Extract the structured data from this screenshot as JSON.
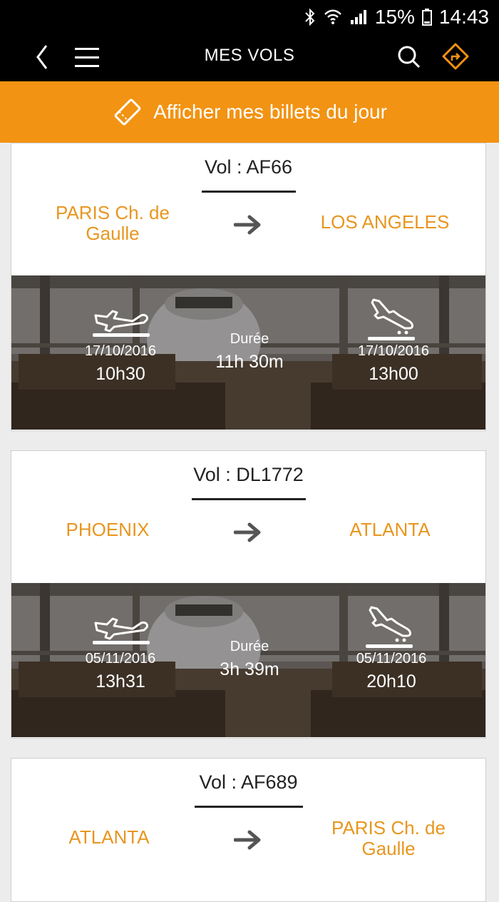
{
  "status_bar": {
    "battery": "15%",
    "time": "14:43"
  },
  "app_bar": {
    "title": "MES VOLS"
  },
  "banner": {
    "label": "Afficher mes billets du jour"
  },
  "flights": [
    {
      "flight_label": "Vol : AF66",
      "from": "PARIS Ch. de Gaulle",
      "to": "LOS ANGELES",
      "departure_date": "17/10/2016",
      "departure_time": "10h30",
      "duration_label": "Durée",
      "duration": "11h 30m",
      "arrival_date": "17/10/2016",
      "arrival_time": "13h00"
    },
    {
      "flight_label": "Vol : DL1772",
      "from": "PHOENIX",
      "to": "ATLANTA",
      "departure_date": "05/11/2016",
      "departure_time": "13h31",
      "duration_label": "Durée",
      "duration": "3h 39m",
      "arrival_date": "05/11/2016",
      "arrival_time": "20h10"
    },
    {
      "flight_label": "Vol : AF689",
      "from": "ATLANTA",
      "to": "PARIS Ch. de Gaulle"
    }
  ],
  "colors": {
    "accent": "#f29313",
    "city_text": "#e8961f",
    "bar": "#000000"
  }
}
